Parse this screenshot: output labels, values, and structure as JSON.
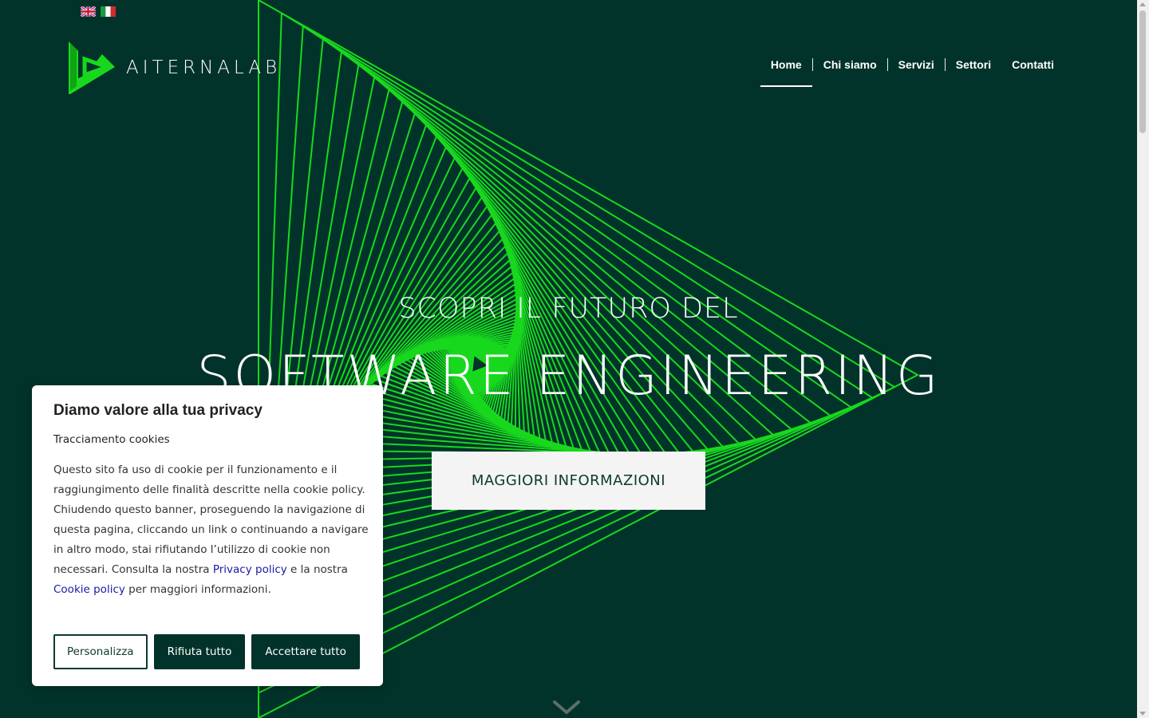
{
  "header": {
    "brand": "AITERNALAB",
    "nav": [
      {
        "label": "Home",
        "active": true
      },
      {
        "label": "Chi siamo"
      },
      {
        "label": "Servizi"
      },
      {
        "label": "Settori"
      },
      {
        "label": "Contatti"
      }
    ],
    "languages": [
      {
        "icon": "uk-flag-icon"
      },
      {
        "icon": "italy-flag-icon"
      }
    ]
  },
  "hero": {
    "pre_title": "SCOPRI IL FUTURO DEL",
    "title": "SOFTWARE ENGINEERING",
    "cta_label": "MAGGIORI INFORMAZIONI",
    "scroll_icon": "chevron-down-icon"
  },
  "cookie_banner": {
    "title": "Diamo valore alla tua privacy",
    "subtitle": "Tracciamento cookies",
    "body_1": "Questo sito fa uso di cookie per il funzionamento e il raggiungimento delle finalità descritte nella cookie policy. Chiudendo questo banner, proseguendo la navigazione di questa pagina, cliccando un link o continuando a navigare in altro modo, stai rifiutando l’utilizzo di cookie non necessari. Consulta la nostra ",
    "privacy_link": "Privacy policy",
    "body_2": " e la nostra ",
    "cookie_link": "Cookie policy",
    "body_3": " per maggiori informazioni.",
    "buttons": {
      "customize": "Personalizza",
      "reject": "Rifiuta tutto",
      "accept": "Accettare tutto"
    }
  },
  "colors": {
    "background": "#02332a",
    "accent_green": "#18d81e",
    "cta_background": "#f4f4f4",
    "link": "#1a1aa8"
  }
}
